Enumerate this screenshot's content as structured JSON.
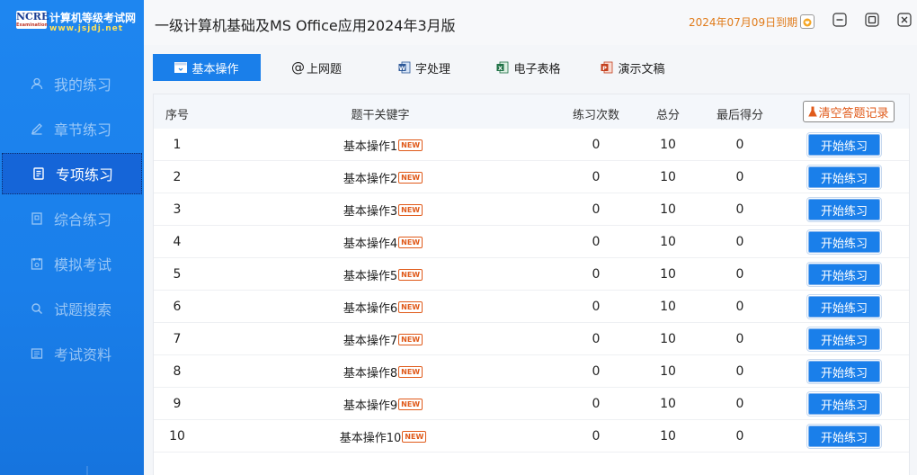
{
  "app": {
    "title": "一级计算机基础及MS Office应用2024年3月版",
    "expiry": "2024年07月09日到期"
  },
  "logo": {
    "mark": "NCRE",
    "mark_sub": "Examination",
    "brand": "计算机等级考试网",
    "url": "www.jsjdj.net"
  },
  "sidebar": {
    "items": [
      {
        "label": "我的练习",
        "icon": "user-icon"
      },
      {
        "label": "章节练习",
        "icon": "pencil-icon"
      },
      {
        "label": "专项练习",
        "icon": "document-icon",
        "active": true
      },
      {
        "label": "综合练习",
        "icon": "book-icon"
      },
      {
        "label": "模拟考试",
        "icon": "exam-icon"
      },
      {
        "label": "试题搜索",
        "icon": "search-icon"
      },
      {
        "label": "考试资料",
        "icon": "folder-icon"
      }
    ]
  },
  "tabs": [
    {
      "label": "基本操作",
      "icon": "window-icon",
      "active": true
    },
    {
      "label": "上网题",
      "icon": "at-icon"
    },
    {
      "label": "字处理",
      "icon": "word-icon"
    },
    {
      "label": "电子表格",
      "icon": "excel-icon"
    },
    {
      "label": "演示文稿",
      "icon": "powerpoint-icon"
    }
  ],
  "table": {
    "headers": {
      "index": "序号",
      "keyword": "题干关键字",
      "count": "练习次数",
      "total": "总分",
      "last": "最后得分"
    },
    "clear_label": "清空答题记录",
    "badge": "NEW",
    "start_label": "开始练习",
    "rows": [
      {
        "index": "1",
        "keyword": "基本操作1",
        "count": "0",
        "total": "10",
        "last": "0"
      },
      {
        "index": "2",
        "keyword": "基本操作2",
        "count": "0",
        "total": "10",
        "last": "0"
      },
      {
        "index": "3",
        "keyword": "基本操作3",
        "count": "0",
        "total": "10",
        "last": "0"
      },
      {
        "index": "4",
        "keyword": "基本操作4",
        "count": "0",
        "total": "10",
        "last": "0"
      },
      {
        "index": "5",
        "keyword": "基本操作5",
        "count": "0",
        "total": "10",
        "last": "0"
      },
      {
        "index": "6",
        "keyword": "基本操作6",
        "count": "0",
        "total": "10",
        "last": "0"
      },
      {
        "index": "7",
        "keyword": "基本操作7",
        "count": "0",
        "total": "10",
        "last": "0"
      },
      {
        "index": "8",
        "keyword": "基本操作8",
        "count": "0",
        "total": "10",
        "last": "0"
      },
      {
        "index": "9",
        "keyword": "基本操作9",
        "count": "0",
        "total": "10",
        "last": "0"
      },
      {
        "index": "10",
        "keyword": "基本操作10",
        "count": "0",
        "total": "10",
        "last": "0"
      }
    ]
  },
  "colors": {
    "sidebar": "#1a7fea",
    "accent": "#1a7fea",
    "warning": "#e05a1a",
    "expiry": "#e07b1a"
  }
}
